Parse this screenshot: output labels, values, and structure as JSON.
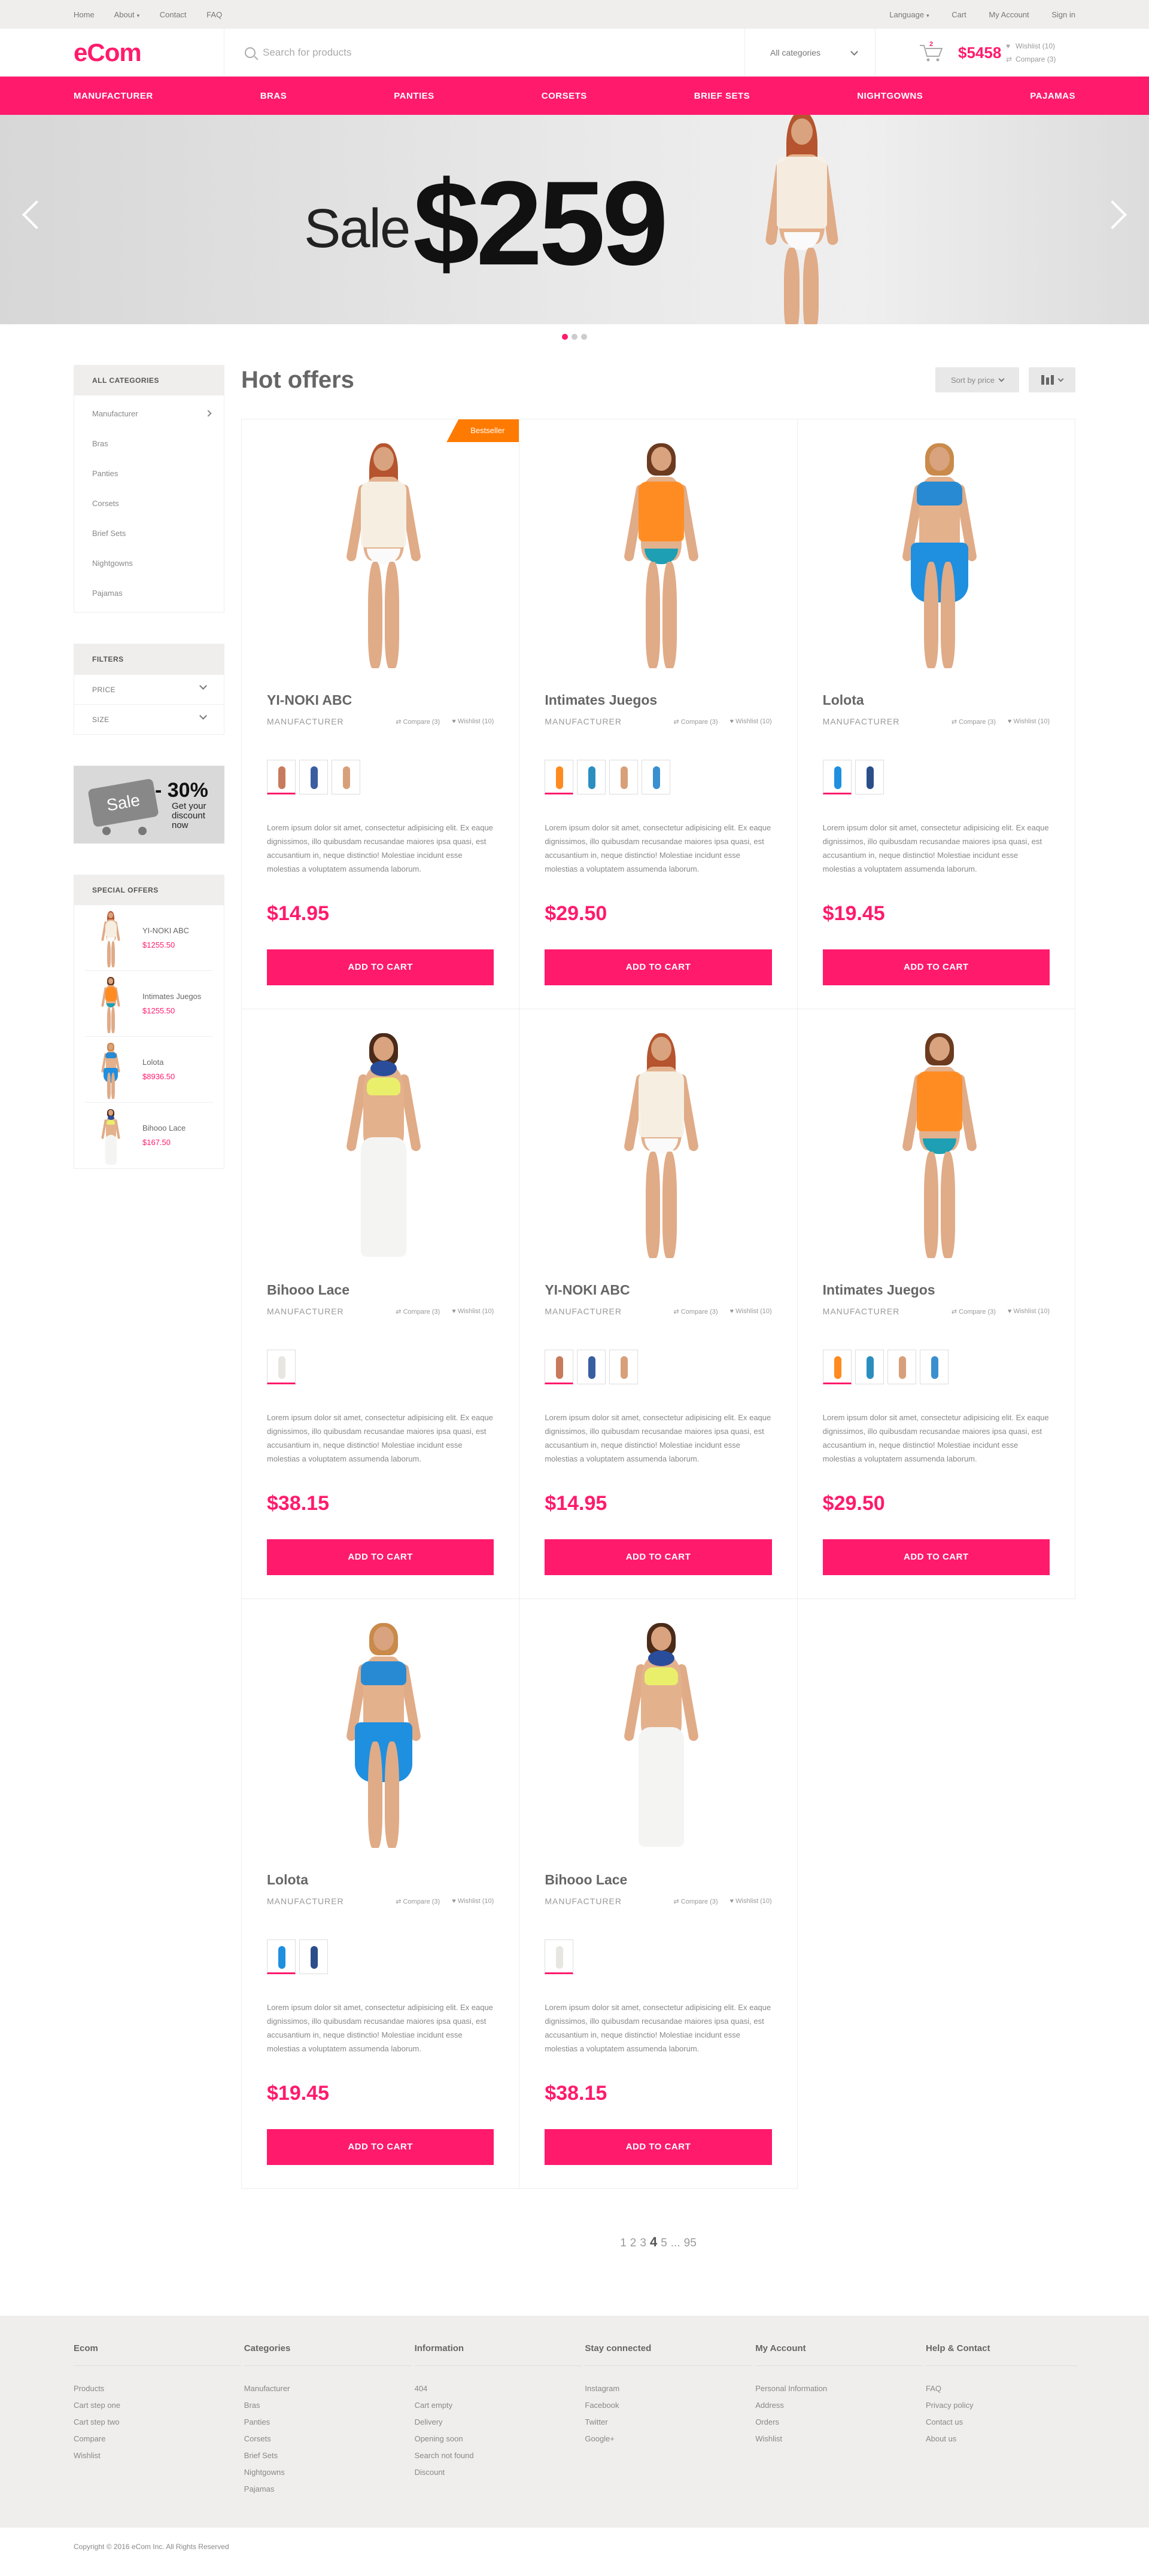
{
  "topbar": {
    "links": [
      "Home",
      "About",
      "Contact",
      "FAQ"
    ],
    "right_links": [
      "Language",
      "Cart",
      "My Account",
      "Sign in"
    ]
  },
  "header": {
    "logo": "eCom",
    "search_placeholder": "Search for products",
    "categories_label": "All categories",
    "cart_count": "2",
    "cart_total": "$5458",
    "wishlist": "Wishlist (10)",
    "compare": "Compare (3)"
  },
  "nav": [
    "MANUFACTURER",
    "BRAS",
    "PANTIES",
    "CORSETS",
    "BRIEF SETS",
    "NIGHTGOWNS",
    "PAJAMAS"
  ],
  "banner": {
    "sale": "Sale",
    "price": "$259",
    "active_slide": 1,
    "slides": 3
  },
  "sidebar": {
    "categories_title": "ALL CATEGORIES",
    "categories": [
      "Manufacturer",
      "Bras",
      "Panties",
      "Corsets",
      "Brief Sets",
      "Nightgowns",
      "Pajamas"
    ],
    "filters_title": "FILTERS",
    "filters": [
      "PRICE",
      "SIZE"
    ],
    "sale_banner": {
      "tag": "Sale",
      "percent": "- 30%",
      "text": "Get your discount now"
    },
    "special_title": "SPECIAL OFFERS",
    "special": [
      {
        "name": "YI-NOKI ABC",
        "price": "$1255.50",
        "style": "white"
      },
      {
        "name": "Intimates Juegos",
        "price": "$1255.50",
        "style": "orange"
      },
      {
        "name": "Lolota",
        "price": "$8936.50",
        "style": "blue"
      },
      {
        "name": "Bihooo Lace",
        "price": "$167.50",
        "style": "pants"
      }
    ]
  },
  "hot": {
    "title": "Hot offers",
    "sort_label": "Sort by price",
    "manufacturer_label": "MANUFACTURER",
    "compare_label": "Compare (3)",
    "wishlist_label": "Wishlist (10)",
    "button_label": "ADD TO CART",
    "description": "Lorem ipsum dolor sit amet, consectetur adipisicing elit. Ex eaque dignissimos, illo quibusdam recusandae maiores ipsa quasi, est accusantium in, neque distinctio! Molestiae incidunt esse molestias a voluptatem assumenda laborum.",
    "products": [
      {
        "name": "YI-NOKI ABC",
        "price": "$14.95",
        "ribbon": "Bestseller",
        "style": "white",
        "swatches": 3
      },
      {
        "name": "Intimates Juegos",
        "price": "$29.50",
        "ribbon": "",
        "style": "orange",
        "swatches": 4
      },
      {
        "name": "Lolota",
        "price": "$19.45",
        "ribbon": "",
        "style": "blue",
        "swatches": 2
      },
      {
        "name": "Bihooo Lace",
        "price": "$38.15",
        "ribbon": "",
        "style": "pants",
        "swatches": 1
      },
      {
        "name": "YI-NOKI ABC",
        "price": "$14.95",
        "ribbon": "",
        "style": "white",
        "swatches": 3
      },
      {
        "name": "Intimates Juegos",
        "price": "$29.50",
        "ribbon": "",
        "style": "orange",
        "swatches": 4
      },
      {
        "name": "Lolota",
        "price": "$19.45",
        "ribbon": "",
        "style": "blue",
        "swatches": 2
      },
      {
        "name": "Bihooo Lace",
        "price": "$38.15",
        "ribbon": "",
        "style": "pants",
        "swatches": 1
      }
    ]
  },
  "pager": {
    "pages": [
      "1",
      "2",
      "3",
      "4",
      "5",
      "...",
      "95"
    ],
    "current": "4"
  },
  "footer": {
    "columns": [
      {
        "title": "Ecom",
        "links": [
          "Products",
          "Cart step one",
          "Cart step two",
          "Compare",
          "Wishlist"
        ]
      },
      {
        "title": "Categories",
        "links": [
          "Manufacturer",
          "Bras",
          "Panties",
          "Corsets",
          "Brief Sets",
          "Nightgowns",
          "Pajamas"
        ]
      },
      {
        "title": "Information",
        "links": [
          "404",
          "Cart empty",
          "Delivery",
          "Opening soon",
          "Search not found",
          "Discount"
        ]
      },
      {
        "title": "Stay connected",
        "links": [
          "Instagram",
          "Facebook",
          "Twitter",
          "Google+"
        ]
      },
      {
        "title": "My Account",
        "links": [
          "Personal Information",
          "Address",
          "Orders",
          "Wishlist"
        ]
      },
      {
        "title": "Help & Contact",
        "links": [
          "FAQ",
          "Privacy policy",
          "Contact us",
          "About us"
        ]
      }
    ],
    "copyright": "Copyright © 2016 eCom Inc. All Rights Reserved"
  },
  "colors": {
    "accent": "#ff1a6c",
    "ribbon": "#ff7a00",
    "panel": "#efeeec"
  },
  "icons": [
    "search-icon",
    "cart-icon",
    "heart-icon",
    "compare-icon",
    "chevron-down-icon",
    "chevron-left-icon",
    "chevron-right-icon",
    "grid-view-icon"
  ]
}
